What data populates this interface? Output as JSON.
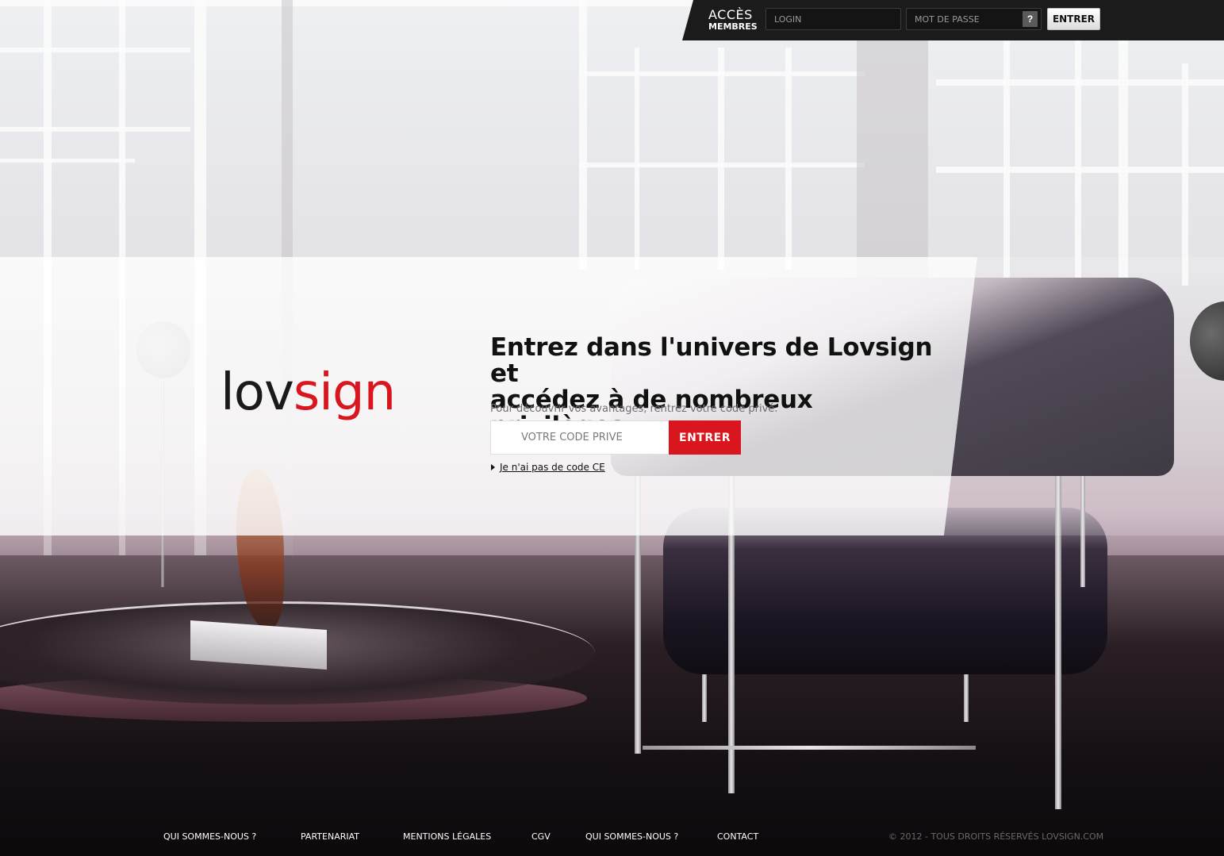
{
  "member_bar": {
    "title_line1": "ACCÈS",
    "title_line2": "MEMBRES",
    "login_placeholder": "LOGIN",
    "password_placeholder": "MOT DE PASSE",
    "help_label": "?",
    "enter_label": "ENTRER"
  },
  "logo": {
    "part1": "lov",
    "part2": "sign",
    "accent_color": "#d9161e"
  },
  "main": {
    "headline_line1": "Entrez dans l'univers de Lovsign et",
    "headline_line2": "accédez à de nombreux privilèges...",
    "subtext": "Pour découvrir vos avantages, rentrez votre code privé.",
    "code_placeholder": "VOTRE CODE PRIVÉ",
    "enter_label": "ENTRER",
    "no_code_link": "Je n'ai pas de code CE"
  },
  "footer": {
    "links": [
      "QUI SOMMES-NOUS ?",
      "PARTENARIAT",
      "MENTIONS LÉGALES",
      "CGV",
      "QUI SOMMES-NOUS ?",
      "CONTACT"
    ],
    "copyright": "© 2012  - TOUS DROITS RÉSERVÉS LOVSIGN.COM"
  },
  "colors": {
    "brand_red": "#d9161e",
    "bar_dark": "#1b1b1b"
  }
}
